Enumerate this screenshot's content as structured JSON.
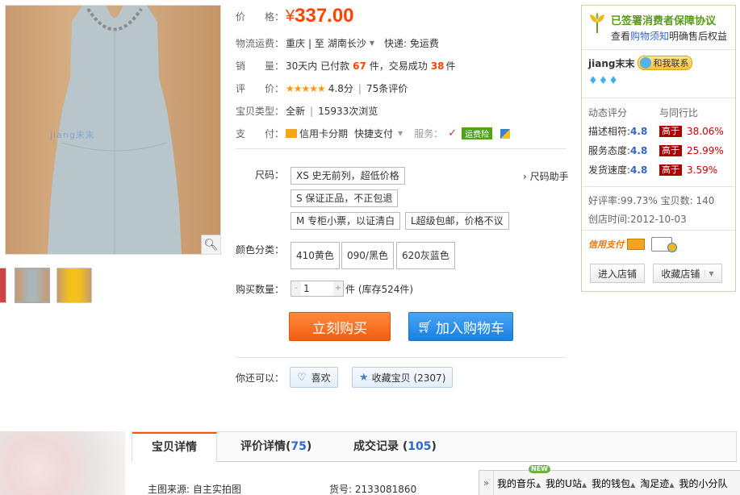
{
  "gallery": {
    "watermark": "jiang末末",
    "zoom_icon": "magnifier-icon",
    "thumbnails": [
      "thumb-red",
      "thumb-grey-dress",
      "thumb-yellow-dress"
    ]
  },
  "product": {
    "price_label": "价　　格：",
    "currency": "¥",
    "price": "337.00",
    "shipping_label": "物流运费：",
    "shipping_from": "重庆",
    "shipping_sep": "| 至",
    "shipping_to": "湖南长沙",
    "shipping_express": "快递: 免运费",
    "sales_label": "销　　量：",
    "sales_prefix": "30天内 已付款",
    "sales_paid": "67",
    "sales_mid": "件，交易成功",
    "sales_done": "38",
    "sales_suffix": "件",
    "rating_label": "评　　价：",
    "rating_stars": "★★★★★",
    "rating_score": "4.8分",
    "rating_count": "75条评价",
    "type_label": "宝贝类型：",
    "type_value": "全新",
    "views": "15933次浏览",
    "pay_label": "支　　付：",
    "pay_credit": "信用卡分期",
    "pay_quick": "快捷支付",
    "service_label": "服务：",
    "service_insurance": "运费险",
    "size_label": "尺码：",
    "sizes": [
      "XS 史无前列，超低价格",
      "S 保证正品，不正包退",
      "M 专柜小票，以证清白",
      "L超级包邮，价格不议"
    ],
    "size_help": "› 尺码助手",
    "color_label": "颜色分类：",
    "colors": [
      "410黄色",
      "090/黑色",
      "620灰蓝色"
    ],
    "qty_label": "购买数量：",
    "qty_value": "1",
    "stock": "件 (库存524件)",
    "buy_now": "立刻购买",
    "add_cart": "加入购物车",
    "also_label": "你还可以：",
    "like": "喜欢",
    "favorite": "收藏宝贝 (2307)"
  },
  "seller": {
    "protection_title": "已签署消费者保障协议",
    "protection_sub_prefix": "查看",
    "protection_link": "购物须知",
    "protection_sub_suffix": "明确售后权益",
    "nickname": "jiang末末",
    "contact": "和我联系",
    "diamonds": "♦♦♦",
    "dsr_title": "动态评分",
    "dsr_compare": "与同行比",
    "dsr": [
      {
        "label": "描述相符:",
        "score": "4.8",
        "tag": "高于",
        "pct": "38.06%"
      },
      {
        "label": "服务态度:",
        "score": "4.8",
        "tag": "高于",
        "pct": "25.99%"
      },
      {
        "label": "发货速度:",
        "score": "4.8",
        "tag": "高于",
        "pct": "3.59%"
      }
    ],
    "good_rate": "好评率:99.73% 宝贝数: 140",
    "created": "创店时间:2012-10-03",
    "credit_label": "信用支付",
    "enter_shop": "进入店铺",
    "fav_shop": "收藏店铺"
  },
  "tabs": [
    {
      "label": "宝贝详情",
      "count": ""
    },
    {
      "label": "评价详情(",
      "count": "75",
      "close": ")"
    },
    {
      "label": "成交记录 (",
      "count": "105",
      "close": ")"
    }
  ],
  "detail": {
    "source": "主图来源: 自主实拍图",
    "item_no": "货号: 2133081860"
  },
  "toolbar": {
    "expand": "»",
    "new_badge": "NEW",
    "items": [
      "我的音乐",
      "我的U站",
      "我的钱包",
      "淘足迹",
      "我的小分队"
    ]
  },
  "colors": {
    "accent_orange": "#ff4400",
    "cart_blue": "#1880e0",
    "seller_border": "#c5d9a7"
  }
}
